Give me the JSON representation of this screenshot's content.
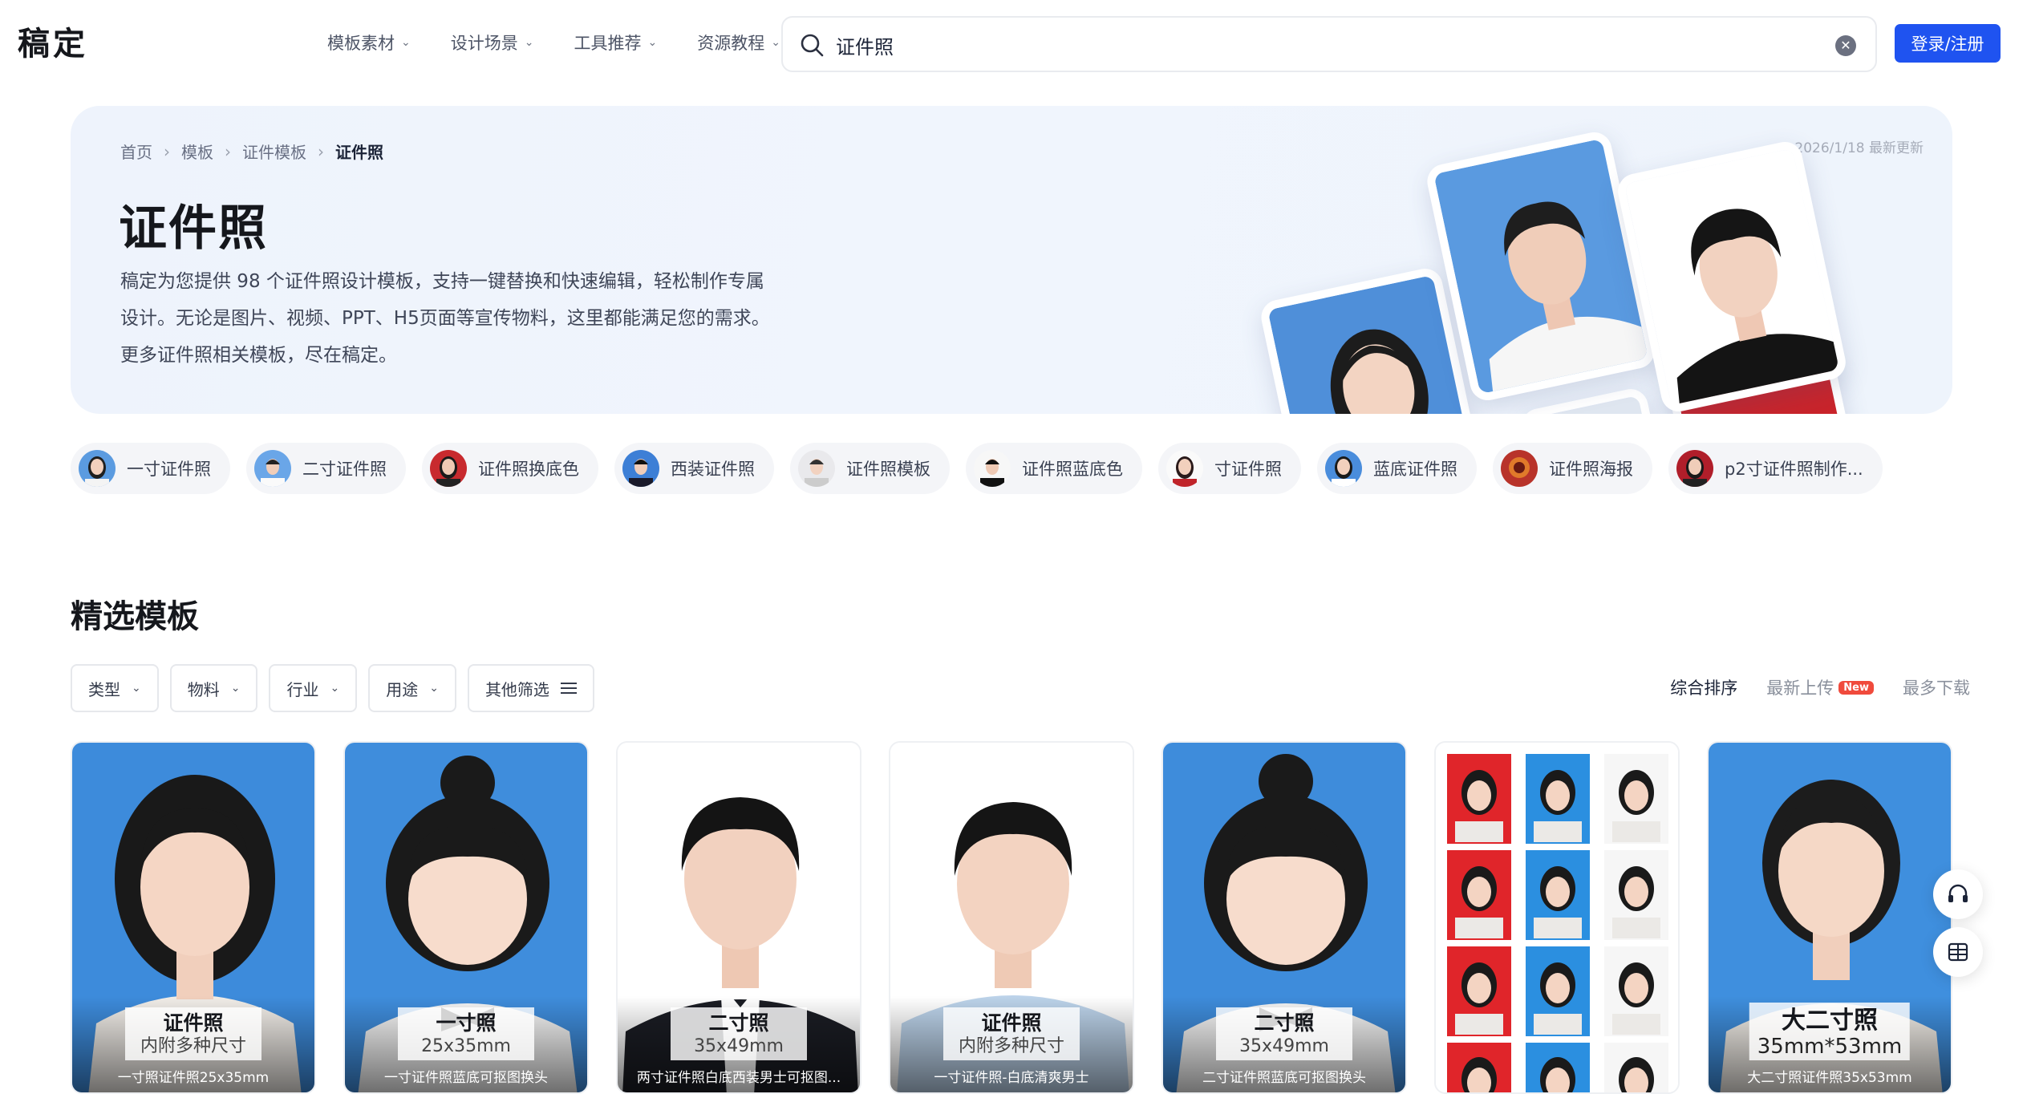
{
  "header": {
    "logo": "稿定",
    "nav": [
      {
        "label": "模板素材"
      },
      {
        "label": "设计场景"
      },
      {
        "label": "工具推荐"
      },
      {
        "label": "资源教程"
      }
    ],
    "search": {
      "value": "证件照",
      "placeholder": ""
    },
    "login_label": "登录/注册"
  },
  "hero": {
    "breadcrumb": [
      "首页",
      "模板",
      "证件模板",
      "证件照"
    ],
    "title": "证件照",
    "desc_lines": [
      "稿定为您提供 98 个证件照设计模板，支持一键替换和快速编辑，轻松制作专属",
      "设计。无论是图片、视频、PPT、H5页面等宣传物料，这里都能满足您的需求。",
      "更多证件照相关模板，尽在稿定。"
    ],
    "date": "2026/1/18 最新更新"
  },
  "chips": [
    {
      "label": "一寸证件照"
    },
    {
      "label": "二寸证件照"
    },
    {
      "label": "证件照换底色"
    },
    {
      "label": "西装证件照"
    },
    {
      "label": "证件照模板"
    },
    {
      "label": "证件照蓝底色"
    },
    {
      "label": "寸证件照"
    },
    {
      "label": "蓝底证件照"
    },
    {
      "label": "证件照海报"
    },
    {
      "label": "p2寸证件照制作..."
    }
  ],
  "section": {
    "title": "精选模板",
    "filters": [
      {
        "label": "类型"
      },
      {
        "label": "物料"
      },
      {
        "label": "行业"
      },
      {
        "label": "用途"
      },
      {
        "label": "其他筛选"
      }
    ],
    "sorts": [
      {
        "label": "综合排序"
      },
      {
        "label": "最新上传",
        "badge": "New"
      },
      {
        "label": "最多下载"
      }
    ]
  },
  "cards": [
    {
      "main": "证件照",
      "sub": "内附多种尺寸",
      "bottom": "一寸照证件照25x35mm"
    },
    {
      "main": "一寸照",
      "sub": "25x35mm",
      "bottom": "一寸证件照蓝底可抠图换头"
    },
    {
      "main": "二寸照",
      "sub": "35x49mm",
      "bottom": "两寸证件照白底西装男士可抠图..."
    },
    {
      "main": "证件照",
      "sub": "内附多种尺寸",
      "bottom": "一寸证件照-白底清爽男士"
    },
    {
      "main": "二寸照",
      "sub": "35x49mm",
      "bottom": "二寸证件照蓝底可抠图换头"
    },
    {
      "main": "",
      "sub": "",
      "bottom": ""
    },
    {
      "main": "大二寸照",
      "sub": "35mm*53mm",
      "bottom": "大二寸照证件照35x53mm"
    }
  ],
  "colors": {
    "accent": "#1f53f0",
    "id_blue": "#3d8bdb",
    "id_red": "#e0252a",
    "new_badge": "#f04a3c"
  },
  "icons": {
    "search": "search-icon",
    "clear": "clear-icon",
    "support": "headset-icon",
    "layout": "layout-icon"
  }
}
